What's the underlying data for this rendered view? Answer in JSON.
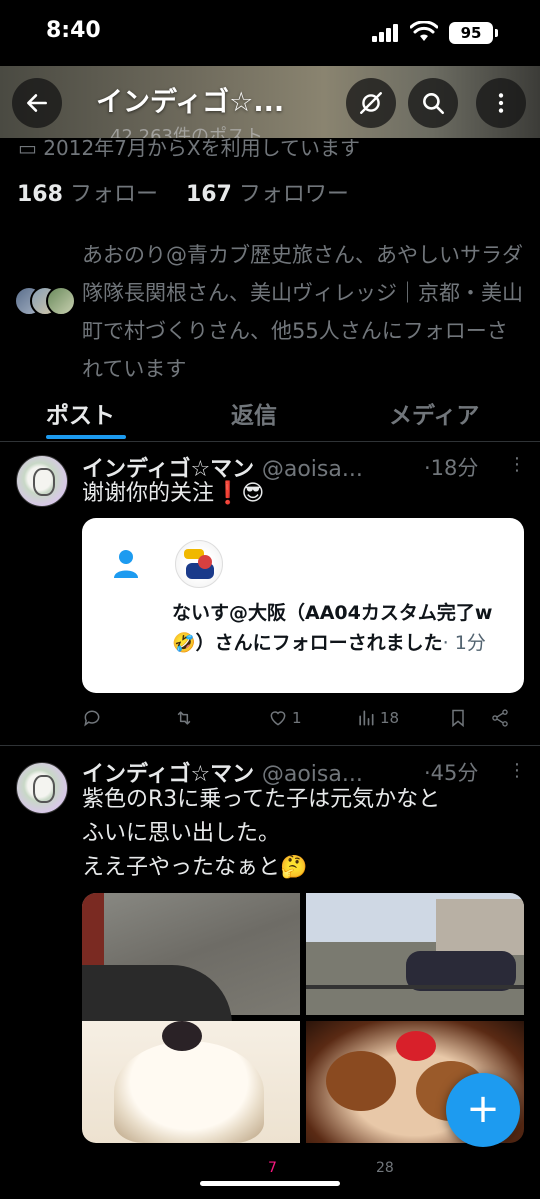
{
  "status_bar": {
    "time": "8:40",
    "battery": "95"
  },
  "header": {
    "title": "インディゴ☆...",
    "post_count": "42,263件のポスト"
  },
  "profile": {
    "joined": "2012年7月からXを利用しています",
    "following_count": "168",
    "following_label": "フォロー",
    "followers_count": "167",
    "followers_label": "フォロワー",
    "followed_by": "あおのり@青カブ歴史旅さん、あやしいサラダ隊隊長関根さん、美山ヴィレッジ｜京都・美山町で村づくりさん、他55人さんにフォローされています"
  },
  "tabs": [
    {
      "label": "ポスト",
      "active": true
    },
    {
      "label": "返信",
      "active": false
    },
    {
      "label": "メディア",
      "active": false
    }
  ],
  "posts": [
    {
      "name": "インディゴ☆マン",
      "handle": "@aoisa...",
      "time": "·18分",
      "text": "谢谢你的关注❗😎",
      "card": {
        "text": "ないす@大阪（AA04カスタム完了w🤣）さんにフォローされました",
        "time": "· 1分"
      },
      "replies": "",
      "reposts": "",
      "likes": "1",
      "views": "18"
    },
    {
      "name": "インディゴ☆マン",
      "handle": "@aoisa...",
      "time": "·45分",
      "text": "紫色のR3に乗ってた子は元気かなと\nふいに思い出した。\nええ子やったなぁと🤔",
      "likes": "7",
      "views": "28"
    }
  ],
  "fab_label": "+",
  "colors": {
    "accent": "#1d9bf0",
    "background": "#000000",
    "muted": "#71767b"
  }
}
